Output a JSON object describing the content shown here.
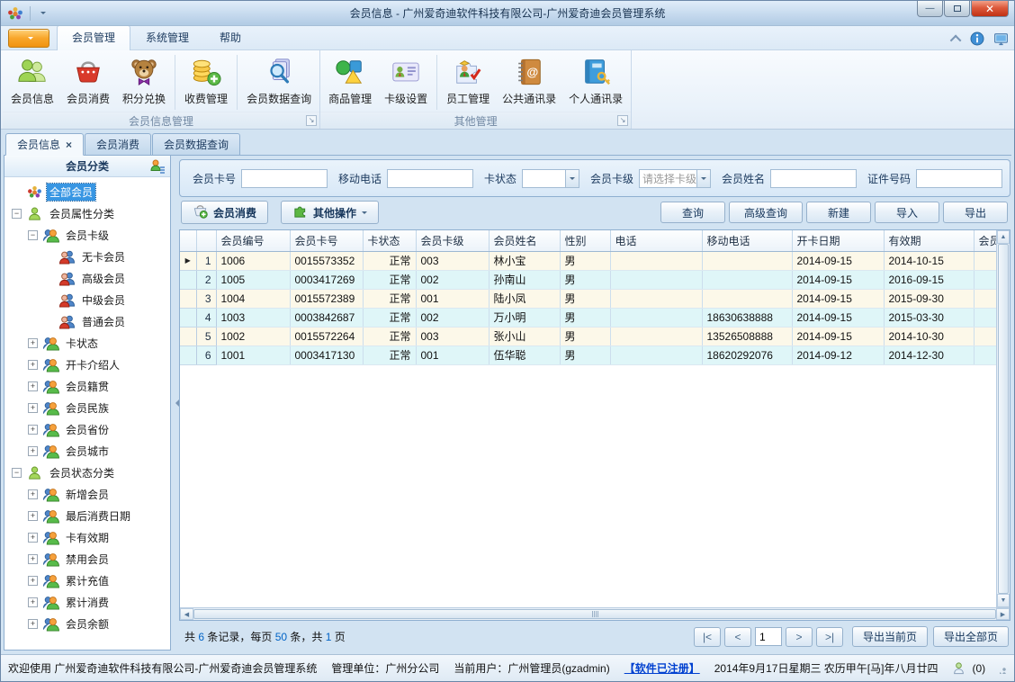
{
  "window": {
    "title": "会员信息 - 广州爱奇迪软件科技有限公司-广州爱奇迪会员管理系统"
  },
  "menu": {
    "tabs": [
      {
        "label": "会员管理",
        "active": true
      },
      {
        "label": "系统管理",
        "active": false
      },
      {
        "label": "帮助",
        "active": false
      }
    ]
  },
  "ribbon": {
    "groups": [
      {
        "label": "会员信息管理",
        "items": [
          {
            "label": "会员信息",
            "icon": "members"
          },
          {
            "label": "会员消费",
            "icon": "basket"
          },
          {
            "label": "积分兑换",
            "icon": "teddy",
            "sep_after": true
          },
          {
            "label": "收费管理",
            "icon": "coins",
            "sep_after": true
          },
          {
            "label": "会员数据查询",
            "icon": "docsearch"
          }
        ]
      },
      {
        "label": "其他管理",
        "items": [
          {
            "label": "商品管理",
            "icon": "shapes"
          },
          {
            "label": "卡级设置",
            "icon": "card",
            "sep_after": true
          },
          {
            "label": "员工管理",
            "icon": "staff"
          },
          {
            "label": "公共通讯录",
            "icon": "abook"
          },
          {
            "label": "个人通讯录",
            "icon": "pbook"
          }
        ]
      }
    ]
  },
  "doc_tabs": [
    {
      "label": "会员信息",
      "active": true,
      "closable": true
    },
    {
      "label": "会员消费",
      "active": false,
      "closable": false
    },
    {
      "label": "会员数据查询",
      "active": false,
      "closable": false
    }
  ],
  "sidebar": {
    "header": "会员分类",
    "tree": [
      {
        "label": "全部会员",
        "level": 0,
        "icon": "treegroup",
        "expander": "none",
        "selected": true
      },
      {
        "label": "会员属性分类",
        "level": 0,
        "icon": "persongreen",
        "expander": "minus"
      },
      {
        "label": "会员卡级",
        "level": 1,
        "icon": "pairorange",
        "expander": "minus"
      },
      {
        "label": "无卡会员",
        "level": 2,
        "icon": "pairred",
        "expander": "none"
      },
      {
        "label": "高级会员",
        "level": 2,
        "icon": "pairred",
        "expander": "none"
      },
      {
        "label": "中级会员",
        "level": 2,
        "icon": "pairred",
        "expander": "none"
      },
      {
        "label": "普通会员",
        "level": 2,
        "icon": "pairred",
        "expander": "none"
      },
      {
        "label": "卡状态",
        "level": 1,
        "icon": "pairorange",
        "expander": "plus"
      },
      {
        "label": "开卡介绍人",
        "level": 1,
        "icon": "pairorange",
        "expander": "plus"
      },
      {
        "label": "会员籍贯",
        "level": 1,
        "icon": "pairorange",
        "expander": "plus"
      },
      {
        "label": "会员民族",
        "level": 1,
        "icon": "pairorange",
        "expander": "plus"
      },
      {
        "label": "会员省份",
        "level": 1,
        "icon": "pairorange",
        "expander": "plus"
      },
      {
        "label": "会员城市",
        "level": 1,
        "icon": "pairorange",
        "expander": "plus"
      },
      {
        "label": "会员状态分类",
        "level": 0,
        "icon": "persongreen",
        "expander": "minus"
      },
      {
        "label": "新增会员",
        "level": 1,
        "icon": "pairorange",
        "expander": "plus"
      },
      {
        "label": "最后消费日期",
        "level": 1,
        "icon": "pairorange",
        "expander": "plus"
      },
      {
        "label": "卡有效期",
        "level": 1,
        "icon": "pairorange",
        "expander": "plus"
      },
      {
        "label": "禁用会员",
        "level": 1,
        "icon": "pairorange",
        "expander": "plus"
      },
      {
        "label": "累计充值",
        "level": 1,
        "icon": "pairorange",
        "expander": "plus"
      },
      {
        "label": "累计消费",
        "level": 1,
        "icon": "pairorange",
        "expander": "plus"
      },
      {
        "label": "会员余额",
        "level": 1,
        "icon": "pairorange",
        "expander": "plus"
      }
    ]
  },
  "search": {
    "fields": [
      {
        "name": "card-no",
        "label": "会员卡号",
        "type": "text",
        "value": ""
      },
      {
        "name": "mobile",
        "label": "移动电话",
        "type": "text",
        "value": ""
      },
      {
        "name": "card-status",
        "label": "卡状态",
        "type": "select",
        "value": "",
        "placeholder": false
      },
      {
        "name": "card-level",
        "label": "会员卡级",
        "type": "select",
        "value": "请选择卡级",
        "placeholder": true
      },
      {
        "name": "member-name",
        "label": "会员姓名",
        "type": "text",
        "value": ""
      },
      {
        "name": "id-number",
        "label": "证件号码",
        "type": "text",
        "value": ""
      }
    ]
  },
  "toolbar": {
    "left": [
      {
        "name": "member-consume",
        "label": "会员消费",
        "icon": "basketplus",
        "dropdown": false
      },
      {
        "name": "other-actions",
        "label": "其他操作",
        "icon": "puzzle",
        "dropdown": true
      }
    ],
    "right": [
      {
        "name": "query",
        "label": "查询"
      },
      {
        "name": "advanced-query",
        "label": "高级查询"
      },
      {
        "name": "new",
        "label": "新建"
      },
      {
        "name": "import",
        "label": "导入"
      },
      {
        "name": "export",
        "label": "导出"
      }
    ]
  },
  "table": {
    "columns": [
      "会员编号",
      "会员卡号",
      "卡状态",
      "会员卡级",
      "会员姓名",
      "性别",
      "电话",
      "移动电话",
      "开卡日期",
      "有效期",
      "会员"
    ],
    "rows": [
      {
        "num": "1",
        "current": true,
        "cells": [
          "1006",
          "0015573352",
          "正常",
          "003",
          "林小宝",
          "男",
          "",
          "",
          "2014-09-15",
          "2014-10-15",
          ""
        ]
      },
      {
        "num": "2",
        "current": false,
        "cells": [
          "1005",
          "0003417269",
          "正常",
          "002",
          "孙南山",
          "男",
          "",
          "",
          "2014-09-15",
          "2016-09-15",
          ""
        ]
      },
      {
        "num": "3",
        "current": false,
        "cells": [
          "1004",
          "0015572389",
          "正常",
          "001",
          "陆小凤",
          "男",
          "",
          "",
          "2014-09-15",
          "2015-09-30",
          ""
        ]
      },
      {
        "num": "4",
        "current": false,
        "cells": [
          "1003",
          "0003842687",
          "正常",
          "002",
          "万小明",
          "男",
          "",
          "18630638888",
          "2014-09-15",
          "2015-03-30",
          ""
        ]
      },
      {
        "num": "5",
        "current": false,
        "cells": [
          "1002",
          "0015572264",
          "正常",
          "003",
          "张小山",
          "男",
          "",
          "13526508888",
          "2014-09-15",
          "2014-10-30",
          ""
        ]
      },
      {
        "num": "6",
        "current": false,
        "cells": [
          "1001",
          "0003417130",
          "正常",
          "001",
          "伍华聪",
          "男",
          "",
          "18620292076",
          "2014-09-12",
          "2014-12-30",
          ""
        ]
      }
    ]
  },
  "pagination": {
    "summary": [
      {
        "text": "共 "
      },
      {
        "text": "6",
        "highlight": true
      },
      {
        "text": " 条记录，每页 "
      },
      {
        "text": "50",
        "highlight": true
      },
      {
        "text": " 条，共 "
      },
      {
        "text": "1",
        "highlight": true
      },
      {
        "text": " 页"
      }
    ],
    "first": "|<",
    "prev": "<",
    "next": ">",
    "last": ">|",
    "page_value": "1",
    "export_current": "导出当前页",
    "export_all": "导出全部页"
  },
  "statusbar": {
    "welcome": "欢迎使用 广州爱奇迪软件科技有限公司-广州爱奇迪会员管理系统",
    "unit": "管理单位：广州分公司",
    "user": "当前用户：广州管理员(gzadmin)",
    "registered": "【软件已注册】",
    "date": "2014年9月17日星期三 农历甲午[马]年八月廿四",
    "count": "(0)"
  }
}
